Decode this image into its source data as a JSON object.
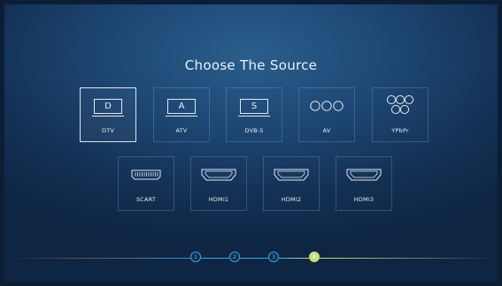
{
  "title": "Choose The Source",
  "sources_row1": [
    {
      "label": "DTV",
      "icon": "letter-box-icon",
      "letter": "D",
      "selected": true
    },
    {
      "label": "ATV",
      "icon": "letter-box-icon",
      "letter": "A",
      "selected": false
    },
    {
      "label": "DVB-S",
      "icon": "letter-box-icon",
      "letter": "S",
      "selected": false
    },
    {
      "label": "AV",
      "icon": "av-circles-icon",
      "selected": false
    },
    {
      "label": "YPbPr",
      "icon": "ypbpr-circles-icon",
      "selected": false
    }
  ],
  "sources_row2": [
    {
      "label": "SCART",
      "icon": "scart-port-icon"
    },
    {
      "label": "HDMI1",
      "icon": "hdmi-port-icon"
    },
    {
      "label": "HDMI2",
      "icon": "hdmi-port-icon"
    },
    {
      "label": "HDMI3",
      "icon": "hdmi-port-icon"
    }
  ],
  "steps": [
    {
      "number": "1",
      "active": false
    },
    {
      "number": "2",
      "active": false
    },
    {
      "number": "3",
      "active": false
    },
    {
      "number": "4",
      "active": true
    }
  ],
  "colors": {
    "step_active": "#c9df7e",
    "step_inactive": "#38a8ee",
    "selected_border": "#d8e6f2"
  }
}
